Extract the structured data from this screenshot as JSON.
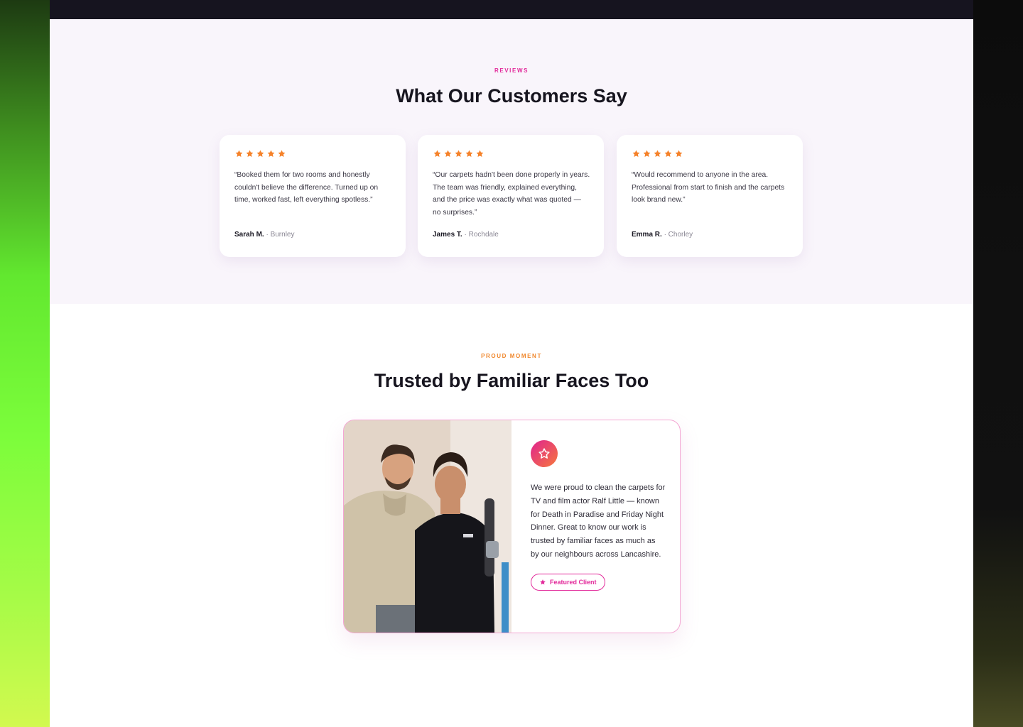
{
  "reviews": {
    "eyebrow": "REVIEWS",
    "heading": "What Our Customers Say",
    "rating_stars": 5,
    "star_color": "#f5822a",
    "cards": [
      {
        "quote": "“Booked them for two rooms and honestly couldn't believe the difference. Turned up on time, worked fast, left everything spotless.”",
        "name": "Sarah M.",
        "location": "· Burnley"
      },
      {
        "quote": "“Our carpets hadn't been done properly in years. The team was friendly, explained everything, and the price was exactly what was quoted — no surprises.”",
        "name": "James T.",
        "location": "· Rochdale"
      },
      {
        "quote": "“Would recommend to anyone in the area. Professional from start to finish and the carpets look brand new.”",
        "name": "Emma R.",
        "location": "· Chorley"
      }
    ]
  },
  "proud": {
    "eyebrow": "PROUD MOMENT",
    "heading": "Trusted by Familiar Faces Too",
    "icon": "star-outline-icon",
    "text": "We were proud to clean the carpets for TV and film actor Ralf Little — known for Death in Paradise and Friday Night Dinner. Great to know our work is trusted by familiar faces as much as by our neighbours across Lancashire.",
    "badge_label": "Featured Client",
    "accent": "#e2299a"
  }
}
